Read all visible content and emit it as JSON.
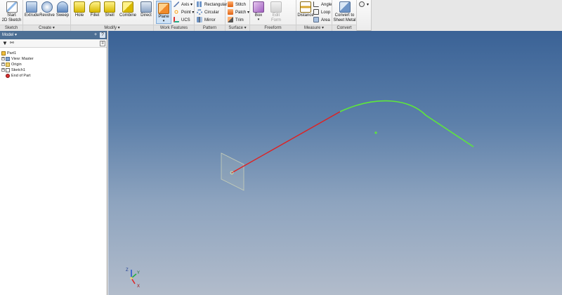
{
  "ribbon": {
    "sketch": {
      "group_label": "Sketch",
      "start_sketch": "Start\n2D Sketch"
    },
    "create": {
      "group_label": "Create",
      "extrude": "Extrude",
      "revolve": "Revolve",
      "sweep": "Sweep"
    },
    "modify": {
      "group_label": "Modify",
      "hole": "Hole",
      "fillet": "Fillet",
      "shell": "Shell",
      "combine": "Combine",
      "direct": "Direct"
    },
    "work_features": {
      "group_label": "Work Features",
      "plane": "Plane",
      "axis": "Axis",
      "point": "Point",
      "ucs": "UCS"
    },
    "pattern": {
      "group_label": "Pattern",
      "rectangular": "Rectangular",
      "circular": "Circular",
      "mirror": "Mirror"
    },
    "surface": {
      "group_label": "Surface",
      "stitch": "Stitch",
      "patch": "Patch",
      "trim": "Trim"
    },
    "freeform": {
      "group_label": "Freeform",
      "box": "Box",
      "edit_form": "Edit\nForm"
    },
    "measure": {
      "group_label": "Measure",
      "distance": "Distance",
      "angle": "Angle",
      "loop": "Loop",
      "area": "Area"
    },
    "convert": {
      "group_label": "Convert",
      "convert_sheet_metal": "Convert to\nSheet Metal"
    }
  },
  "browser": {
    "title": "Model",
    "items": [
      {
        "label": "Part1"
      },
      {
        "label": "View: Master"
      },
      {
        "label": "Origin"
      },
      {
        "label": "Sketch1"
      },
      {
        "label": "End of Part"
      }
    ]
  },
  "triad": {
    "x": "X",
    "y": "Y",
    "z": "Z"
  },
  "colors": {
    "line_selected": "#e02020",
    "curve": "#5ee83a",
    "viewport_top": "#3a6296",
    "viewport_bottom": "#b2bccb",
    "panel_header": "#4d6f94"
  }
}
